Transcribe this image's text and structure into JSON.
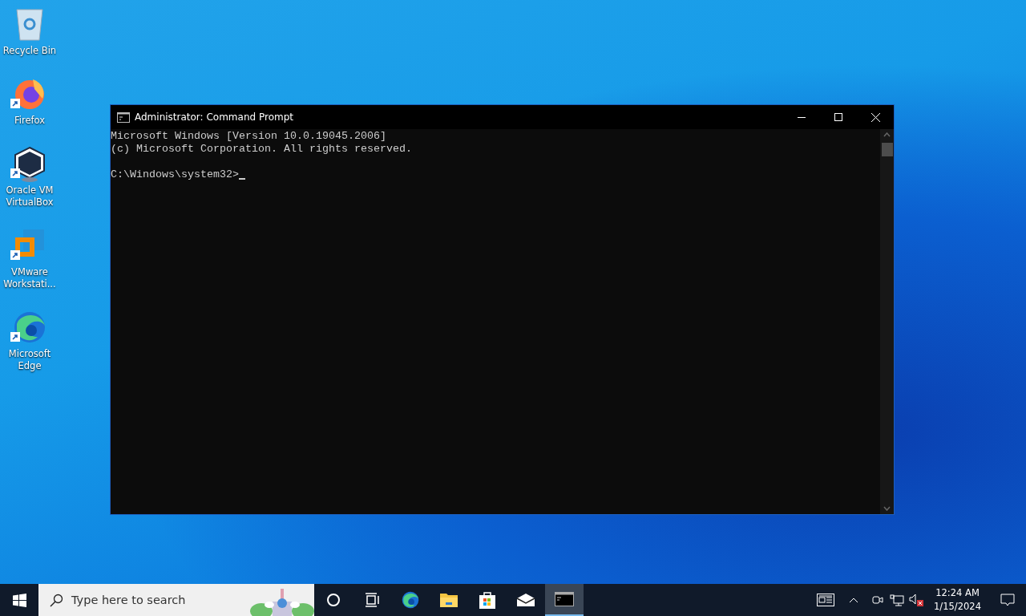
{
  "desktop_icons": [
    {
      "label": "Recycle Bin",
      "kind": "recycle",
      "shortcut": false
    },
    {
      "label": "Firefox",
      "kind": "firefox",
      "shortcut": true
    },
    {
      "label": "Oracle VM VirtualBox",
      "kind": "virtualbox",
      "shortcut": true
    },
    {
      "label": "VMware Workstati...",
      "kind": "vmware",
      "shortcut": true
    },
    {
      "label": "Microsoft Edge",
      "kind": "edge",
      "shortcut": true
    }
  ],
  "window": {
    "title": "Administrator: Command Prompt",
    "output": [
      "Microsoft Windows [Version 10.0.19045.2006]",
      "(c) Microsoft Corporation. All rights reserved."
    ],
    "prompt": "C:\\Windows\\system32>"
  },
  "taskbar": {
    "search": {
      "placeholder": "Type here to search"
    },
    "apps": [
      {
        "kind": "cortana",
        "selected": false
      },
      {
        "kind": "taskview",
        "selected": false
      },
      {
        "kind": "edge",
        "selected": false
      },
      {
        "kind": "explorer",
        "selected": false
      },
      {
        "kind": "store",
        "selected": false
      },
      {
        "kind": "mail",
        "selected": false
      },
      {
        "kind": "cmd",
        "selected": true
      }
    ],
    "tray": {
      "volume_muted": true,
      "time": "12:24 AM",
      "date": "1/15/2024"
    }
  }
}
